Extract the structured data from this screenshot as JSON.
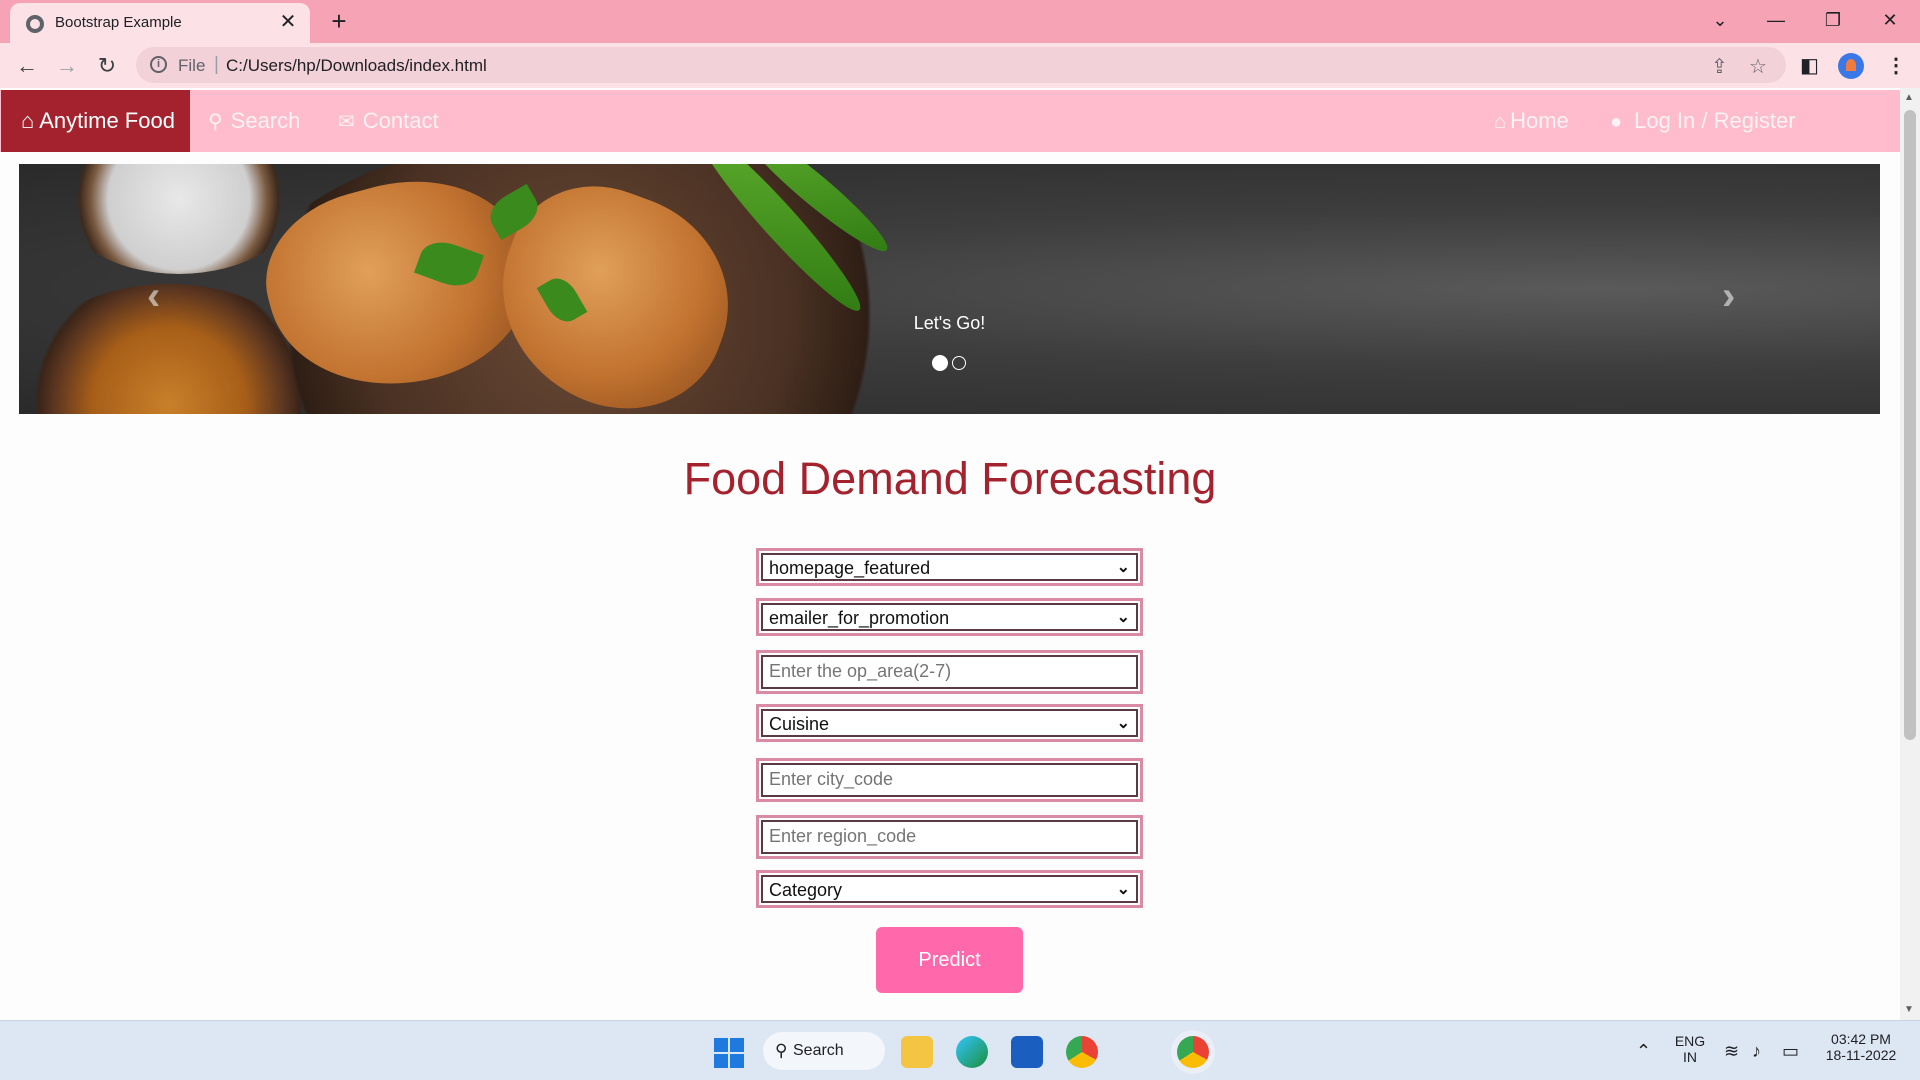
{
  "browser": {
    "tab_title": "Bootstrap Example",
    "tab_close": "✕",
    "new_tab": "+",
    "url_scheme": "File",
    "url": "C:/Users/hp/Downloads/index.html",
    "window_controls": [
      "⌄",
      "—",
      "❐",
      "✕"
    ]
  },
  "navbar": {
    "brand": "Anytime Food",
    "links": [
      {
        "label": "Search",
        "icon": "search-icon"
      },
      {
        "label": "Contact",
        "icon": "envelope-icon"
      }
    ],
    "right_links": [
      {
        "label": "Home",
        "icon": "home-icon"
      },
      {
        "label": "Log In / Register",
        "icon": "user-icon"
      }
    ]
  },
  "carousel": {
    "caption": "Let's Go!",
    "prev_label": "‹",
    "next_label": "›",
    "slide_count": 2,
    "active_index": 0
  },
  "main": {
    "title": "Food Demand Forecasting",
    "fields": [
      {
        "type": "select",
        "value": "homepage_featured"
      },
      {
        "type": "select",
        "value": "emailer_for_promotion"
      },
      {
        "type": "input",
        "placeholder": "Enter the op_area(2-7)"
      },
      {
        "type": "select",
        "value": "Cuisine"
      },
      {
        "type": "input",
        "placeholder": "Enter city_code"
      },
      {
        "type": "input",
        "placeholder": "Enter region_code"
      },
      {
        "type": "select",
        "value": "Category"
      }
    ],
    "predict_label": "Predict"
  },
  "taskbar": {
    "search_label": "Search",
    "lang": "ENG",
    "region": "IN",
    "time": "03:42 PM",
    "date": "18-11-2022"
  },
  "colors": {
    "brand": "#a3222d",
    "navbar": "#ffbccc",
    "button": "#ff69ac",
    "titlebar": "#f5a3b5"
  }
}
